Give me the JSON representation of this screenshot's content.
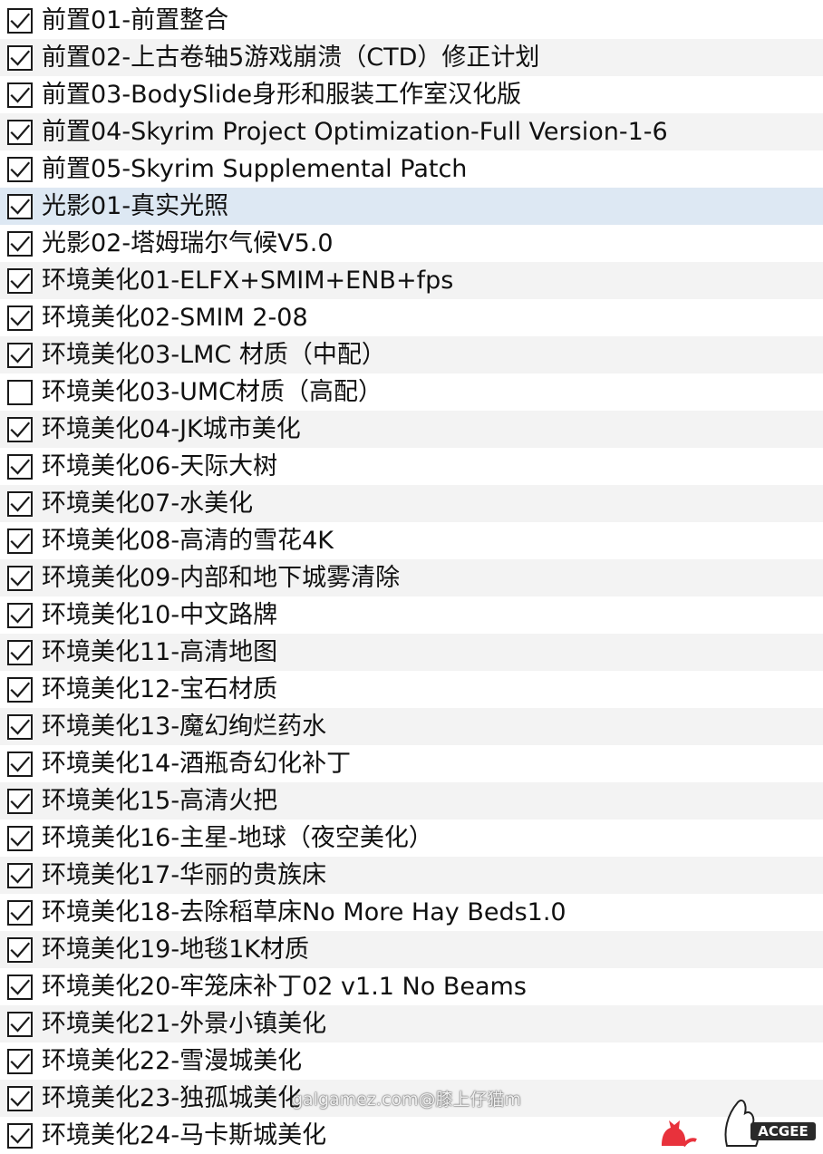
{
  "colors": {
    "row_alt": "#f3f3f3",
    "row_selected": "#dde8f3",
    "text": "#111111",
    "checkbox_border": "#1a1a1a",
    "logo_red": "#e8323c"
  },
  "items": [
    {
      "label": "前置01-前置整合",
      "checked": true
    },
    {
      "label": "前置02-上古卷轴5游戏崩溃（CTD）修正计划",
      "checked": true
    },
    {
      "label": "前置03-BodySlide身形和服装工作室汉化版",
      "checked": true
    },
    {
      "label": "前置04-Skyrim Project Optimization-Full Version-1-6",
      "checked": true
    },
    {
      "label": "前置05-Skyrim Supplemental Patch",
      "checked": true
    },
    {
      "label": "光影01-真实光照",
      "checked": true,
      "selected": true
    },
    {
      "label": "光影02-塔姆瑞尔气候V5.0",
      "checked": true
    },
    {
      "label": "环境美化01-ELFX+SMIM+ENB+fps",
      "checked": true
    },
    {
      "label": "环境美化02-SMIM 2-08",
      "checked": true
    },
    {
      "label": "环境美化03-LMC 材质（中配）",
      "checked": true
    },
    {
      "label": "环境美化03-UMC材质（高配）",
      "checked": false
    },
    {
      "label": "环境美化04-JK城市美化",
      "checked": true
    },
    {
      "label": "环境美化06-天际大树",
      "checked": true
    },
    {
      "label": "环境美化07-水美化",
      "checked": true
    },
    {
      "label": "环境美化08-高清的雪花4K",
      "checked": true
    },
    {
      "label": "环境美化09-内部和地下城雾清除",
      "checked": true
    },
    {
      "label": "环境美化10-中文路牌",
      "checked": true
    },
    {
      "label": "环境美化11-高清地图",
      "checked": true
    },
    {
      "label": "环境美化12-宝石材质",
      "checked": true
    },
    {
      "label": "环境美化13-魔幻绚烂药水",
      "checked": true
    },
    {
      "label": "环境美化14-酒瓶奇幻化补丁",
      "checked": true
    },
    {
      "label": "环境美化15-高清火把",
      "checked": true
    },
    {
      "label": "环境美化16-主星-地球（夜空美化）",
      "checked": true
    },
    {
      "label": "环境美化17-华丽的贵族床",
      "checked": true
    },
    {
      "label": "环境美化18-去除稻草床No More Hay Beds1.0",
      "checked": true
    },
    {
      "label": "环境美化19-地毯1K材质",
      "checked": true
    },
    {
      "label": "环境美化20-牢笼床补丁02 v1.1 No Beams",
      "checked": true
    },
    {
      "label": "环境美化21-外景小镇美化",
      "checked": true
    },
    {
      "label": "环境美化22-雪漫城美化",
      "checked": true
    },
    {
      "label": "环境美化23-独孤城美化",
      "checked": true
    },
    {
      "label": "环境美化24-马卡斯城美化",
      "checked": true
    }
  ],
  "watermark": {
    "text": "galgamez.com@膝上仔猫m"
  },
  "logo": {
    "text": "ACGEE",
    "icon": "cat-silhouette-icon"
  }
}
